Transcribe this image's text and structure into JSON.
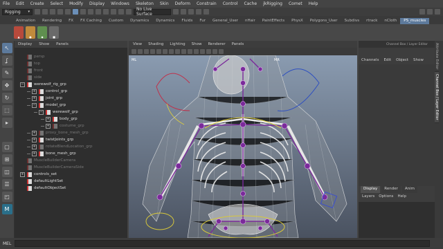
{
  "menubar": {
    "items": [
      "File",
      "Edit",
      "Create",
      "Select",
      "Modify",
      "Display",
      "Windows",
      "Skeleton",
      "Skin",
      "Deform",
      "Constrain",
      "Control",
      "Cache",
      "jkRigging",
      "Comet",
      "Help"
    ]
  },
  "statusline": {
    "mode": "Rigging",
    "live_surface": "No Live Surface"
  },
  "shelf_tabs": [
    "Animation",
    "Rendering",
    "FX",
    "FX Caching",
    "Custom",
    "Dynamics",
    "Dynamics",
    "Fluids",
    "Fur",
    "General_User",
    "nHair",
    "PaintEffects",
    "PhysX",
    "Polygons_User",
    "Subdivs",
    "rtrack",
    "nCloth",
    "PS_muscles"
  ],
  "shelf_active_index": 17,
  "shelf_icons": [
    {
      "label": "",
      "color": "#b84a3c"
    },
    {
      "label": "",
      "color": "#c08a3c"
    },
    {
      "label": "",
      "color": "#5f8f4f"
    },
    {
      "label": "",
      "color": "#6a6a6a"
    }
  ],
  "outliner": {
    "menu": [
      "Display",
      "Show",
      "Panels"
    ],
    "items": [
      {
        "label": "persp",
        "dim": true,
        "indent": 0,
        "expand": ""
      },
      {
        "label": "top",
        "dim": true,
        "indent": 0,
        "expand": ""
      },
      {
        "label": "front",
        "dim": true,
        "indent": 0,
        "expand": ""
      },
      {
        "label": "side",
        "dim": true,
        "indent": 0,
        "expand": ""
      },
      {
        "label": "werewolf_rig_grp",
        "dim": false,
        "indent": 0,
        "expand": "−"
      },
      {
        "label": "control_grp",
        "dim": false,
        "indent": 1,
        "expand": "+"
      },
      {
        "label": "joint_grp",
        "dim": false,
        "indent": 1,
        "expand": "+"
      },
      {
        "label": "model_grp",
        "dim": false,
        "indent": 1,
        "expand": "−"
      },
      {
        "label": "werewolf_grp",
        "dim": false,
        "indent": 2,
        "expand": "−"
      },
      {
        "label": "body_grp",
        "dim": false,
        "indent": 3,
        "expand": "+"
      },
      {
        "label": "costume_grp",
        "dim": true,
        "indent": 3,
        "expand": "+"
      },
      {
        "label": "proxy_bone_mesh_grp",
        "dim": true,
        "indent": 1,
        "expand": "+"
      },
      {
        "label": "twistJoints_grp",
        "dim": false,
        "indent": 1,
        "expand": "+"
      },
      {
        "label": "rotateBlendLocation_grp",
        "dim": true,
        "indent": 1,
        "expand": "+"
      },
      {
        "label": "bone_mesh_grp",
        "dim": false,
        "indent": 1,
        "expand": "+"
      },
      {
        "label": "MuscleBuilderCamera",
        "dim": true,
        "indent": 0,
        "expand": ""
      },
      {
        "label": "MuscleBuilderCameraSide",
        "dim": true,
        "indent": 0,
        "expand": ""
      },
      {
        "label": "controls_set",
        "dim": false,
        "indent": 0,
        "expand": "+"
      },
      {
        "label": "defaultLightSet",
        "dim": false,
        "indent": 0,
        "expand": ""
      },
      {
        "label": "defaultObjectSet",
        "dim": false,
        "indent": 0,
        "expand": ""
      }
    ]
  },
  "viewport": {
    "menu": [
      "View",
      "Shading",
      "Lighting",
      "Show",
      "Renderer",
      "Panels"
    ],
    "bg_top": "#8a9bb0",
    "bg_bottom": "#4a5260",
    "indicators": [
      "ML",
      "MR"
    ]
  },
  "channelbox": {
    "header": "Channel Box / Layer Editor",
    "menu": [
      "Channels",
      "Edit",
      "Object",
      "Show"
    ],
    "layer_tabs": [
      "Display",
      "Render",
      "Anim"
    ],
    "layer_active_index": 0,
    "layer_menu": [
      "Layers",
      "Options",
      "Help"
    ]
  },
  "side_tabs": [
    "Attribute Editor",
    "Channel Box / Layer Editor"
  ],
  "side_tab_active_index": 1,
  "cmdline": {
    "label": "MEL"
  }
}
